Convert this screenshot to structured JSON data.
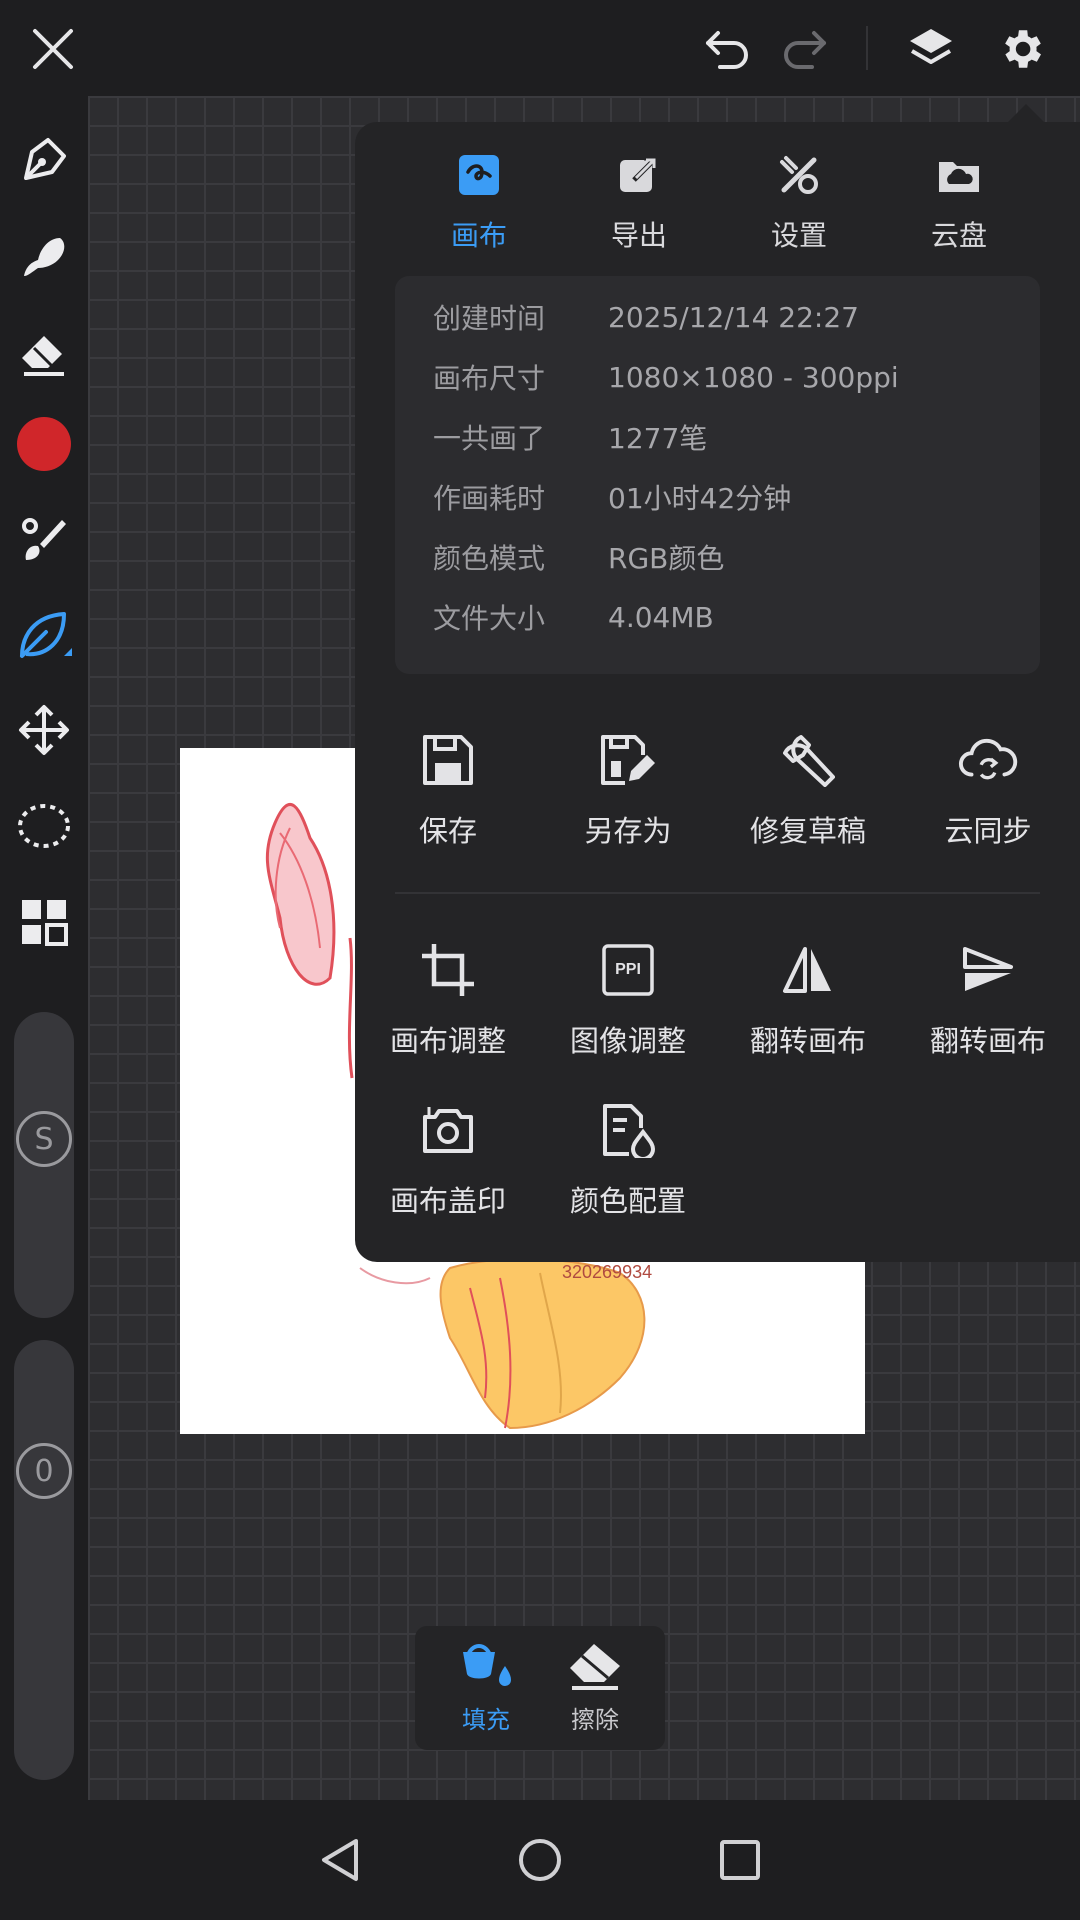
{
  "topbar": {
    "close_icon": "close-icon",
    "undo_icon": "undo-icon",
    "redo_icon": "redo-icon",
    "layers_icon": "layers-icon",
    "settings_icon": "gear-icon"
  },
  "left_toolbar": {
    "tools": [
      "pen-tool-icon",
      "smudge-tool-icon",
      "eraser-tool-icon",
      "color-swatch",
      "brush-tool-icon",
      "leaf-brush-icon",
      "transform-icon",
      "lasso-icon",
      "grid-icon"
    ],
    "active_tool": "leaf-brush-icon",
    "current_color": "#d0262a",
    "size_slider_label": "S",
    "opacity_slider_label": "0"
  },
  "panel": {
    "tabs": [
      {
        "label": "画布",
        "icon": "canvas-icon",
        "active": true
      },
      {
        "label": "导出",
        "icon": "export-icon",
        "active": false
      },
      {
        "label": "设置",
        "icon": "tools-icon",
        "active": false
      },
      {
        "label": "云盘",
        "icon": "cloud-drive-icon",
        "active": false
      }
    ],
    "info": [
      {
        "key": "创建时间",
        "value": "2025/12/14 22:27"
      },
      {
        "key": "画布尺寸",
        "value": "1080×1080 - 300ppi"
      },
      {
        "key": "一共画了",
        "value": "1277笔"
      },
      {
        "key": "作画耗时",
        "value": "01小时42分钟"
      },
      {
        "key": "颜色模式",
        "value": "RGB颜色"
      },
      {
        "key": "文件大小",
        "value": "4.04MB"
      }
    ],
    "actions_row1": [
      {
        "label": "保存",
        "icon": "save-icon"
      },
      {
        "label": "另存为",
        "icon": "save-as-icon"
      },
      {
        "label": "修复草稿",
        "icon": "wrench-icon"
      },
      {
        "label": "云同步",
        "icon": "cloud-sync-icon"
      }
    ],
    "actions_row2": [
      {
        "label": "画布调整",
        "icon": "crop-icon"
      },
      {
        "label": "图像调整",
        "icon": "ppi-icon",
        "icon_text": "PPI"
      },
      {
        "label": "翻转画布",
        "icon": "flip-horizontal-icon"
      },
      {
        "label": "翻转画布",
        "icon": "flip-vertical-icon"
      }
    ],
    "actions_row3": [
      {
        "label": "画布盖印",
        "icon": "camera-icon"
      },
      {
        "label": "颜色配置",
        "icon": "color-profile-icon"
      }
    ]
  },
  "fill_bar": {
    "fill_label": "填充",
    "erase_label": "擦除"
  },
  "artboard": {
    "watermark_text": "320269934"
  },
  "navbar": [
    "back-icon",
    "home-icon",
    "recents-icon"
  ],
  "colors": {
    "accent": "#3b9cf5",
    "panel_bg": "#242426",
    "canvas_bg": "#2d2d30"
  }
}
